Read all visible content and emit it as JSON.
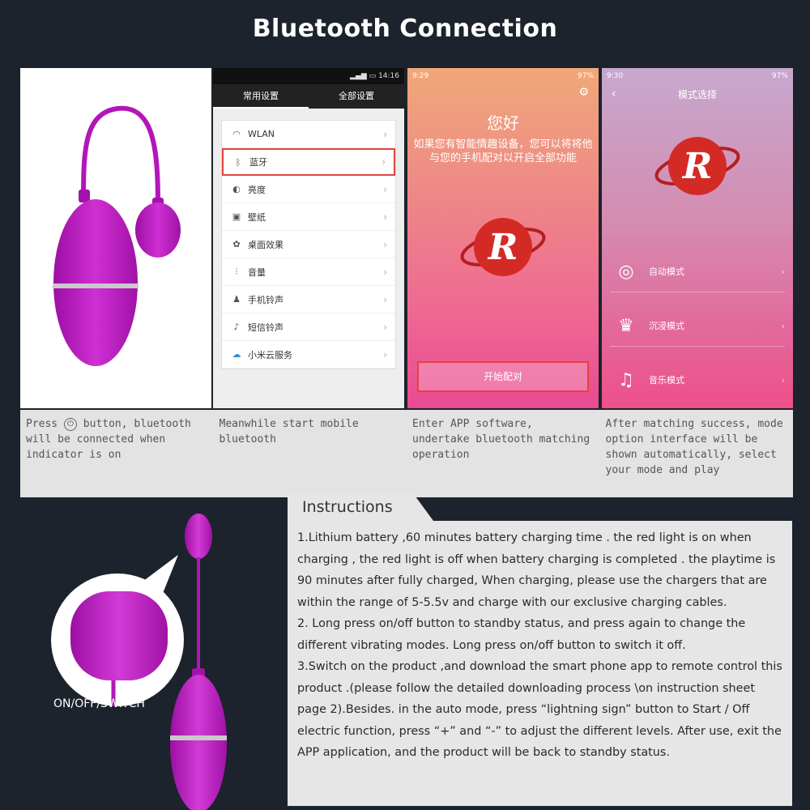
{
  "title": "Bluetooth Connection",
  "settings_screen": {
    "status_time": "14:16",
    "tabs": [
      "常用设置",
      "全部设置"
    ],
    "items": [
      {
        "icon": "wifi-icon",
        "label": "WLAN"
      },
      {
        "icon": "bluetooth-icon",
        "label": "蓝牙"
      },
      {
        "icon": "brightness-icon",
        "label": "亮度"
      },
      {
        "icon": "wallpaper-icon",
        "label": "壁纸"
      },
      {
        "icon": "desktop-effect-icon",
        "label": "桌面效果"
      },
      {
        "icon": "volume-icon",
        "label": "音量"
      },
      {
        "icon": "ringtone-icon",
        "label": "手机铃声"
      },
      {
        "icon": "sms-tone-icon",
        "label": "短信铃声"
      },
      {
        "icon": "cloud-icon",
        "label": "小米云服务"
      }
    ]
  },
  "app_welcome": {
    "status_time": "9:29",
    "battery": "97%",
    "hello": "您好",
    "intro": "如果您有智能情趣设备，您可以将将他与您的手机配对以开启全部功能",
    "start_button": "开始配对"
  },
  "app_modes": {
    "status_time": "9:30",
    "battery": "97%",
    "title": "模式选择",
    "modes": [
      {
        "icon": "auto-mode-icon",
        "label": "自动模式"
      },
      {
        "icon": "immersive-mode-icon",
        "label": "沉浸模式"
      },
      {
        "icon": "music-mode-icon",
        "label": "音乐模式"
      }
    ]
  },
  "captions": {
    "step1_a": "Press",
    "step1_b": "button, bluetooth will be connected when indicator is on",
    "step2": "Meanwhile start mobile bluetooth",
    "step3": "Enter APP software, undertake bluetooth matching operation",
    "step4": "After matching success, mode option interface will be shown automatically, select your mode and play"
  },
  "instructions": {
    "heading": "Instructions",
    "paragraphs": [
      "1.Lithium battery ,60 minutes battery charging time . the red light is on when charging , the red light is off when battery charging is completed  . the playtime is 90 minutes after fully charged, When charging, please use the chargers that are within the range of 5-5.5v and charge with our exclusive charging cables.",
      "2. Long press on/off button to standby status, and press again to change the different vibrating modes. Long press on/off button to switch it off.",
      "3.Switch on the product ,and download the  smart phone app to remote control  this product .(please follow the detailed downloading process \\on instruction sheet page 2).Besides. in the auto mode, press “lightning sign” button to Start / Off electric function, press “+” and “-” to adjust the different levels. After use, exit the APP application, and the product will be back to standby status."
    ]
  },
  "button_label": "ON/OFF/SWITCH",
  "colors": {
    "product": "#b316b8",
    "highlight": "#e0443f",
    "background": "#1c232c"
  }
}
